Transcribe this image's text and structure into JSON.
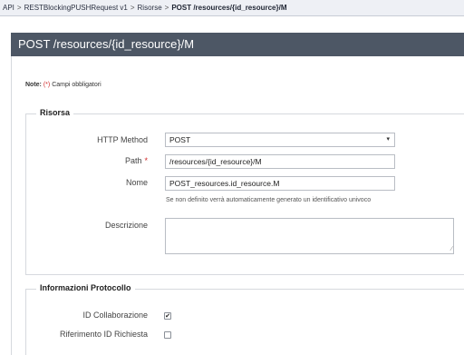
{
  "breadcrumb": {
    "items": [
      "API",
      "RESTBlockingPUSHRequest v1",
      "Risorse",
      "POST /resources/{id_resource}/M"
    ],
    "separator": ">"
  },
  "header": {
    "title": "POST /resources/{id_resource}/M"
  },
  "note": {
    "label": "Note:",
    "required_marker": "(*)",
    "text": "Campi obbligatori"
  },
  "risorsa": {
    "legend": "Risorsa",
    "http_method": {
      "label": "HTTP Method",
      "value": "POST"
    },
    "path": {
      "label": "Path",
      "required": "*",
      "value": "/resources/{id_resource}/M"
    },
    "nome": {
      "label": "Nome",
      "value": "POST_resources.id_resource.M",
      "help": "Se non definito verrà automaticamente generato un identificativo univoco"
    },
    "descrizione": {
      "label": "Descrizione",
      "value": ""
    }
  },
  "protocollo": {
    "legend": "Informazioni Protocollo",
    "id_collaborazione": {
      "label": "ID Collaborazione",
      "checked": true
    },
    "riferimento_id": {
      "label": "Riferimento ID Richiesta",
      "checked": false
    }
  },
  "icons": {
    "dropdown": "chevron-down-icon",
    "checkmark": "check-icon",
    "resize": "resize-grip-icon"
  },
  "colors": {
    "title_bar": "#4d5765",
    "required": "#d02a2a",
    "breadcrumb_bg": "#eef0f5"
  }
}
